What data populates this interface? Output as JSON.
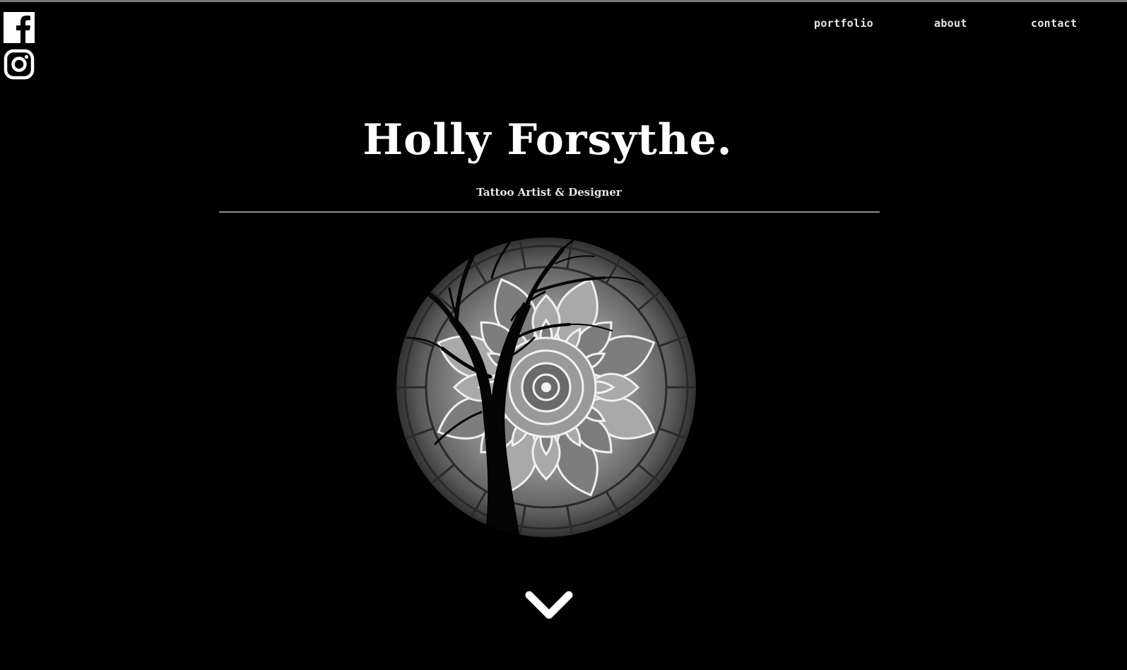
{
  "site": {
    "title": "Holly Forsythe.",
    "subtitle": "Tattoo Artist & Designer"
  },
  "nav": {
    "items": [
      {
        "label": "portfolio"
      },
      {
        "label": "about"
      },
      {
        "label": "contact"
      }
    ]
  },
  "social": {
    "icons": [
      "facebook-icon",
      "instagram-icon"
    ]
  },
  "hero": {
    "image": "circular mandala with tree silhouette artwork"
  },
  "scroll": {
    "icon": "chevron-down-icon"
  },
  "colors": {
    "background": "#000000",
    "text": "#ffffff",
    "divider": "#8a8a8a"
  }
}
